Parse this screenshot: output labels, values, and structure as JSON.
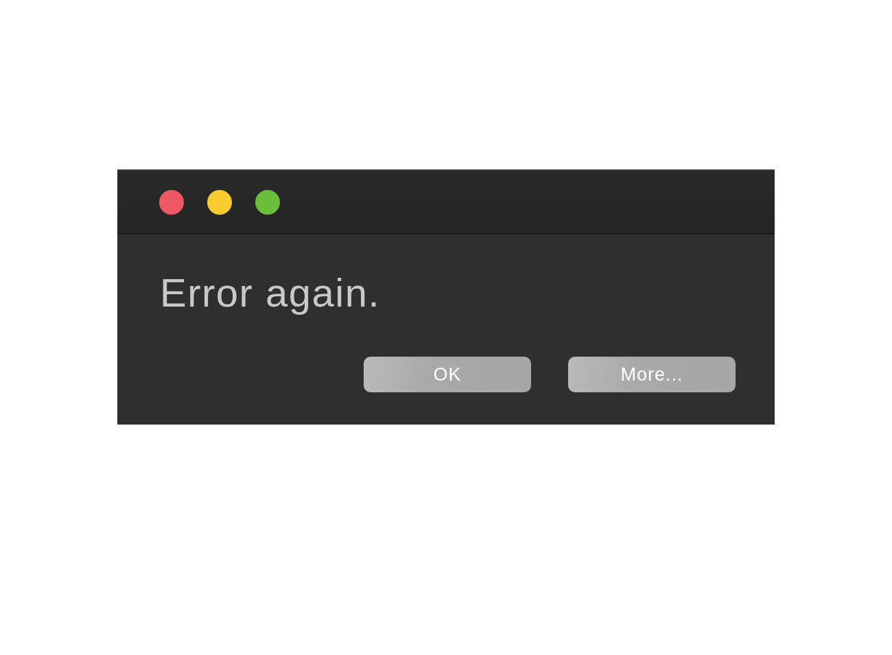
{
  "window": {
    "controls": [
      {
        "color": "#ee5766"
      },
      {
        "color": "#fbcc2f"
      },
      {
        "color": "#6bbd3c"
      }
    ]
  },
  "message": "Error again.",
  "buttons": [
    {
      "label": "OK"
    },
    {
      "label": "More..."
    }
  ]
}
